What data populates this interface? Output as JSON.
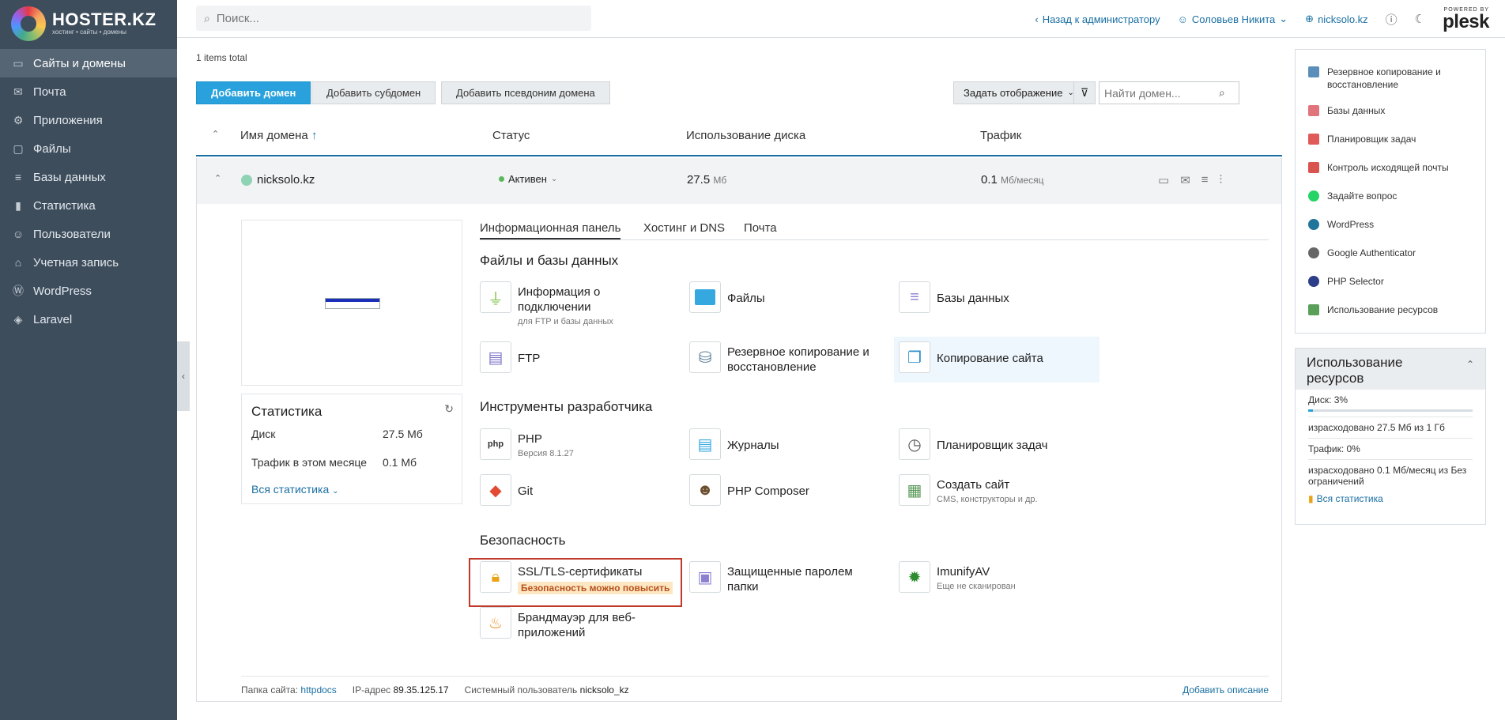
{
  "brand": {
    "name": "HOSTER.",
    "name_suffix": "KZ",
    "tagline": "хостинг • сайты • домены"
  },
  "nav": [
    {
      "label": "Сайты и домены",
      "icon": "monitor-icon",
      "active": true
    },
    {
      "label": "Почта",
      "icon": "mail-icon"
    },
    {
      "label": "Приложения",
      "icon": "gear-icon"
    },
    {
      "label": "Файлы",
      "icon": "folder-icon"
    },
    {
      "label": "Базы данных",
      "icon": "database-icon"
    },
    {
      "label": "Статистика",
      "icon": "bar-chart-icon"
    },
    {
      "label": "Пользователи",
      "icon": "user-icon"
    },
    {
      "label": "Учетная запись",
      "icon": "account-icon"
    },
    {
      "label": "WordPress",
      "icon": "wordpress-icon"
    },
    {
      "label": "Laravel",
      "icon": "laravel-icon"
    }
  ],
  "topbar": {
    "search_placeholder": "Поиск...",
    "back_admin": "Назад к администратору",
    "user": "Соловьев Никита",
    "site": "nicksolo.kz",
    "powered_by": "POWERED BY",
    "plesk": "plesk"
  },
  "main": {
    "items_total": "1 items total",
    "buttons": {
      "add_domain": "Добавить домен",
      "add_subdomain": "Добавить субдомен",
      "add_alias": "Добавить псевдоним домена",
      "view": "Задать отображение"
    },
    "domain_search_placeholder": "Найти домен...",
    "columns": {
      "name": "Имя домена",
      "status": "Статус",
      "disk": "Использование диска",
      "traffic": "Трафик"
    },
    "row": {
      "domain": "nicksolo.kz",
      "status": "Активен",
      "disk_value": "27.5",
      "disk_unit": "Мб",
      "traffic_value": "0.1",
      "traffic_unit": "Мб/месяц"
    },
    "stats": {
      "title": "Статистика",
      "disk_label": "Диск",
      "disk_value": "27.5 Мб",
      "traffic_label": "Трафик в этом месяце",
      "traffic_value": "0.1 Мб",
      "all_link": "Вся статистика"
    },
    "tabs": [
      "Информационная панель",
      "Хостинг и DNS",
      "Почта"
    ],
    "sections": {
      "files": "Файлы и базы данных",
      "dev": "Инструменты разработчика",
      "security": "Безопасность"
    },
    "tools": {
      "connection": {
        "name": "Информация о подключении",
        "sub": "для FTP и базы данных"
      },
      "files": {
        "name": "Файлы"
      },
      "databases": {
        "name": "Базы данных"
      },
      "ftp": {
        "name": "FTP"
      },
      "backup": {
        "name": "Резервное копирование и восстановление"
      },
      "copy": {
        "name": "Копирование сайта"
      },
      "php": {
        "name": "PHP",
        "sub": "Версия 8.1.27"
      },
      "logs": {
        "name": "Журналы"
      },
      "scheduler": {
        "name": "Планировщик задач"
      },
      "git": {
        "name": "Git"
      },
      "composer": {
        "name": "PHP Composer"
      },
      "create_site": {
        "name": "Создать сайт",
        "sub": "CMS, конструкторы и др."
      },
      "ssl": {
        "name": "SSL/TLS-сертификаты",
        "warn": "Безопасность можно повысить"
      },
      "protected": {
        "name": "Защищенные паролем папки"
      },
      "imunify": {
        "name": "ImunifyAV",
        "sub": "Еще не сканирован"
      },
      "firewall": {
        "name": "Брандмауэр для веб-приложений"
      }
    },
    "footer": {
      "folder_label": "Папка сайта:",
      "folder_value": "httpdocs",
      "ip_label": "IP-адрес",
      "ip_value": "89.35.125.17",
      "user_label": "Системный пользователь",
      "user_value": "nicksolo_kz",
      "add_description": "Добавить описание"
    }
  },
  "right": {
    "links": [
      {
        "label": "Резервное копирование и восстановление",
        "icon": "backup-icon",
        "color": "#5b8fb9"
      },
      {
        "label": "Базы данных",
        "icon": "database-icon",
        "color": "#e0737c"
      },
      {
        "label": "Планировщик задач",
        "icon": "scheduler-icon",
        "color": "#e05a5a"
      },
      {
        "label": "Контроль исходящей почты",
        "icon": "mail-icon",
        "color": "#d9534f"
      },
      {
        "label": "Задайте вопрос",
        "icon": "whatsapp-icon",
        "color": "#25d366"
      },
      {
        "label": "WordPress",
        "icon": "wordpress-icon",
        "color": "#21759b"
      },
      {
        "label": "Google Authenticator",
        "icon": "authenticator-icon",
        "color": "#666666"
      },
      {
        "label": "PHP Selector",
        "icon": "php-icon",
        "color": "#2c3e88"
      },
      {
        "label": "Использование ресурсов",
        "icon": "chart-icon",
        "color": "#5aa05a"
      }
    ],
    "usage": {
      "title": "Использование ресурсов",
      "disk": "Диск: 3%",
      "disk_percent": 3,
      "disk_used": "израсходовано 27.5 Мб из 1 Гб",
      "traffic": "Трафик: 0%",
      "traffic_used": "израсходовано 0.1 Мб/месяц из Без ограничений",
      "all_link": "Вся статистика"
    }
  }
}
